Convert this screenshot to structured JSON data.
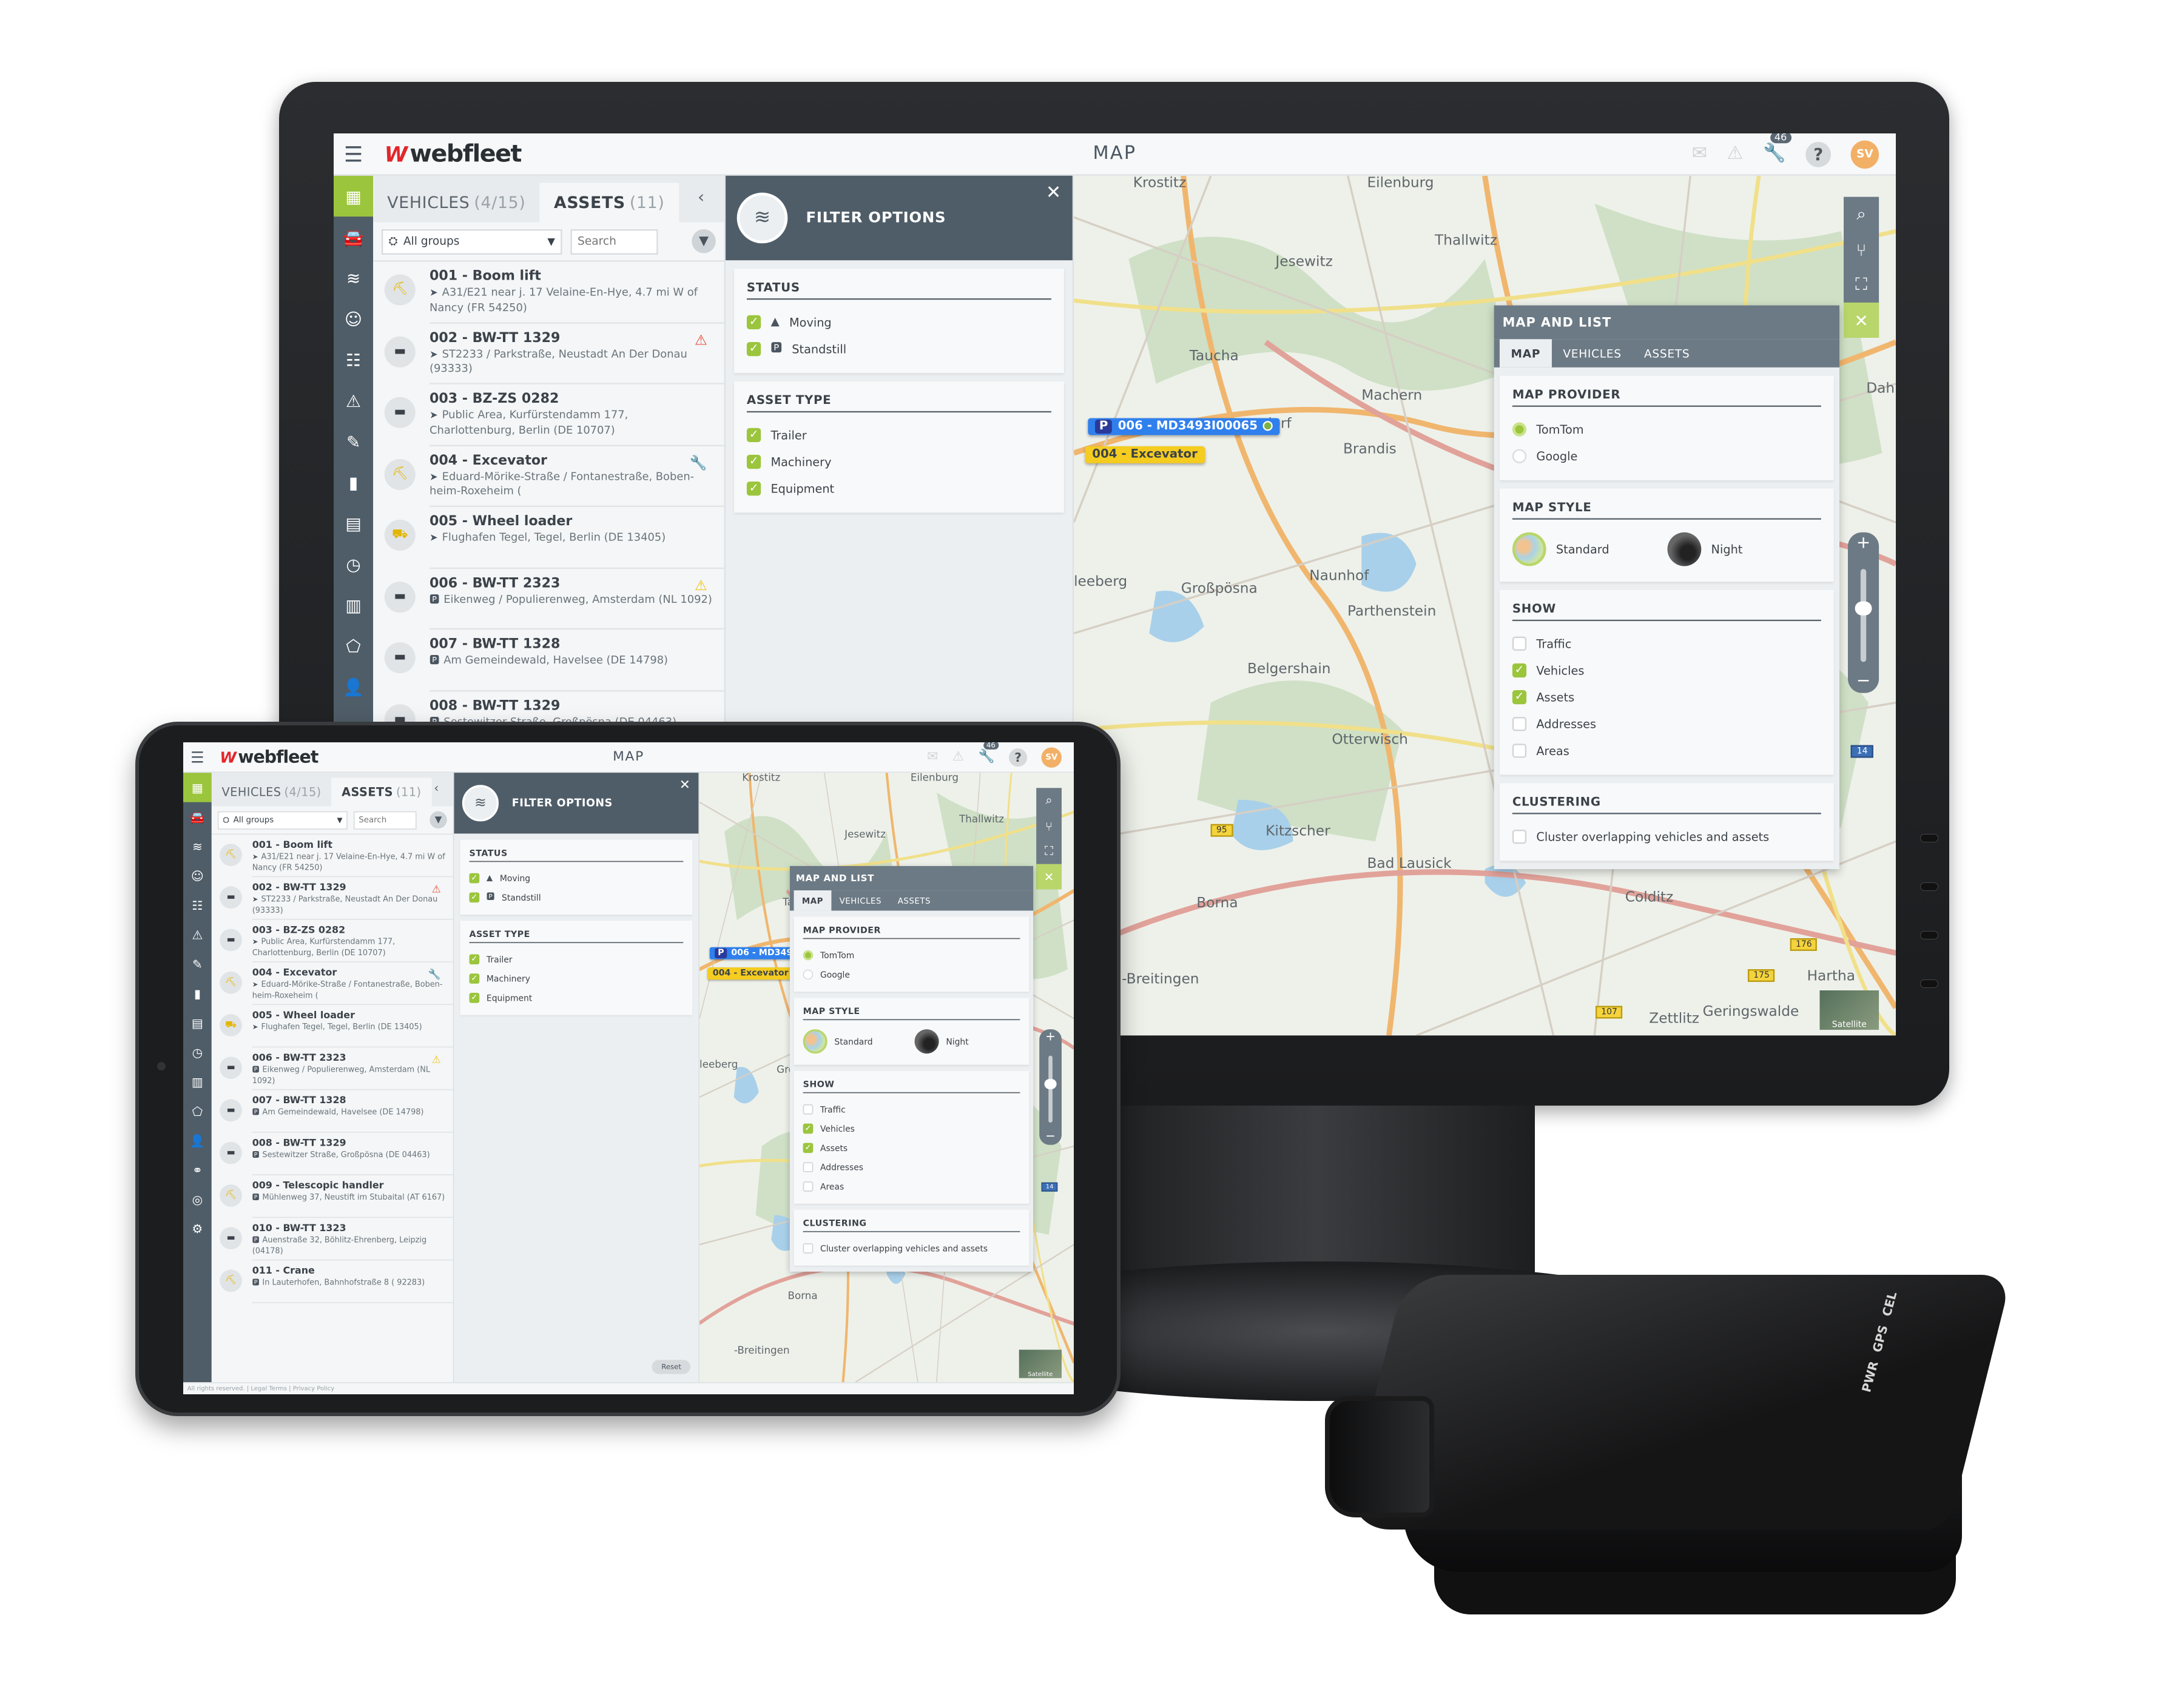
{
  "header": {
    "logo": "webfleet",
    "title": "MAP",
    "notification_count": "46",
    "avatar_initials": "SV",
    "icons": [
      "menu-icon",
      "mail-icon",
      "warning-icon",
      "wrench-icon",
      "help-icon"
    ]
  },
  "nav": {
    "items": [
      "map-icon",
      "car-icon",
      "asset-icon",
      "driver-icon",
      "clipboard-icon",
      "warning-icon",
      "wrench-icon",
      "chart-icon",
      "pdf-icon",
      "clock-icon",
      "building-icon",
      "polygon-icon",
      "person-icon",
      "link-icon",
      "target-icon",
      "gear-icon"
    ],
    "active": "map-icon"
  },
  "list": {
    "tabs": [
      {
        "label": "VEHICLES",
        "count": "(4/15)"
      },
      {
        "label": "ASSETS",
        "count": "(11)"
      }
    ],
    "active_tab": "ASSETS",
    "group_select": "All groups",
    "search_placeholder": "Search",
    "items": [
      {
        "title": "001 - Boom lift",
        "status": "moving",
        "address": "A31/E21 near j. 17 Velaine-En-Hye, 4.7 mi W of Nancy (FR 54250)",
        "alert": ""
      },
      {
        "title": "002 - BW-TT 1329",
        "status": "moving",
        "address": "ST2233 / Parkstraße, Neustadt An Der Donau (93333)",
        "alert": "red-warning"
      },
      {
        "title": "003 - BZ-ZS 0282",
        "status": "moving",
        "address": "Public Area, Kurfürstendamm 177, Charlottenburg, Berlin (DE 10707)",
        "alert": ""
      },
      {
        "title": "004 - Excevator",
        "status": "moving",
        "address": "Eduard-Mörike-Straße / Fontanestraße, Boben-heim-Roxeheim (",
        "alert": "wrench"
      },
      {
        "title": "005 - Wheel loader",
        "status": "moving",
        "address": "Flughafen Tegel, Tegel, Berlin (DE 13405)",
        "alert": ""
      },
      {
        "title": "006 - BW-TT 2323",
        "status": "standstill",
        "address": "Eikenweg / Populierenweg, Amsterdam (NL 1092)",
        "alert": "yellow-warning"
      },
      {
        "title": "007 - BW-TT 1328",
        "status": "standstill",
        "address": "Am Gemeindewald, Havelsee (DE 14798)",
        "alert": ""
      },
      {
        "title": "008 - BW-TT 1329",
        "status": "standstill",
        "address": "Sestewitzer Straße, Großpösna (DE 04463)",
        "alert": ""
      },
      {
        "title": "009 - Telescopic handler",
        "status": "standstill",
        "address": "Mühlenweg 37, Neustift im Stubaital (AT 6167)",
        "alert": ""
      },
      {
        "title": "010 - BW-TT 1323",
        "status": "standstill",
        "address": "Auenstraße 32, Böhlitz-Ehrenberg, Leipzig (04178)",
        "alert": ""
      },
      {
        "title": "011 - Crane",
        "status": "standstill",
        "address": "In Lauterhofen, Bahnhofstraße 8 ( 92283)",
        "alert": ""
      }
    ]
  },
  "filter": {
    "title": "FILTER OPTIONS",
    "status": {
      "heading": "STATUS",
      "options": [
        {
          "label": "Moving",
          "checked": true
        },
        {
          "label": "Standstill",
          "checked": true
        }
      ]
    },
    "asset_type": {
      "heading": "ASSET TYPE",
      "options": [
        {
          "label": "Trailer",
          "checked": true
        },
        {
          "label": "Machinery",
          "checked": true
        },
        {
          "label": "Equipment",
          "checked": true
        }
      ]
    },
    "reset_label": "Reset"
  },
  "map": {
    "places": [
      "Krostitz",
      "Eilenburg",
      "Jesewitz",
      "Thallwitz",
      "Taucha",
      "Machern",
      "Brandis",
      "Naunhof",
      "Großpösna",
      "Parthenstein",
      "Belgershain",
      "Otterwisch",
      "Kitzscher",
      "Bad Lausick",
      "Borna",
      "Colditz",
      "Hartha",
      "Zettlitz",
      "Geringswalde",
      "Dah",
      "leeberg",
      "-Breitingen",
      "sdorf"
    ],
    "road_badges": [
      "95",
      "176",
      "175",
      "107",
      "14"
    ],
    "markers": [
      {
        "label": "006 - MD3493I00065",
        "badge": "P",
        "color": "#2f80ed"
      },
      {
        "label": "004 - Excevator",
        "color": "#f5cc1f"
      }
    ],
    "satellite_label": "Satellite"
  },
  "map_and_list": {
    "title": "MAP AND LIST",
    "tabs": [
      "MAP",
      "VEHICLES",
      "ASSETS"
    ],
    "active_tab": "MAP",
    "provider": {
      "heading": "MAP PROVIDER",
      "options": [
        {
          "label": "TomTom",
          "selected": true
        },
        {
          "label": "Google",
          "selected": false
        }
      ]
    },
    "style": {
      "heading": "MAP STYLE",
      "options": [
        {
          "label": "Standard",
          "selected": true
        },
        {
          "label": "Night",
          "selected": false
        }
      ]
    },
    "show": {
      "heading": "SHOW",
      "options": [
        {
          "label": "Traffic",
          "checked": false
        },
        {
          "label": "Vehicles",
          "checked": true
        },
        {
          "label": "Assets",
          "checked": true
        },
        {
          "label": "Addresses",
          "checked": false
        },
        {
          "label": "Areas",
          "checked": false
        }
      ]
    },
    "clustering": {
      "heading": "CLUSTERING",
      "option": {
        "label": "Cluster overlapping vehicles and assets",
        "checked": false
      }
    }
  },
  "footer": {
    "copyright": "All rights reserved.",
    "legal": "Legal Terms",
    "privacy": "Privacy Policy"
  },
  "device": {
    "leds": [
      "PWR",
      "GPS",
      "CEL"
    ]
  },
  "colors": {
    "accent": "#9bc53d",
    "nav": "#4f5d68",
    "brand_red": "#e3262b",
    "avatar": "#f2b067"
  }
}
